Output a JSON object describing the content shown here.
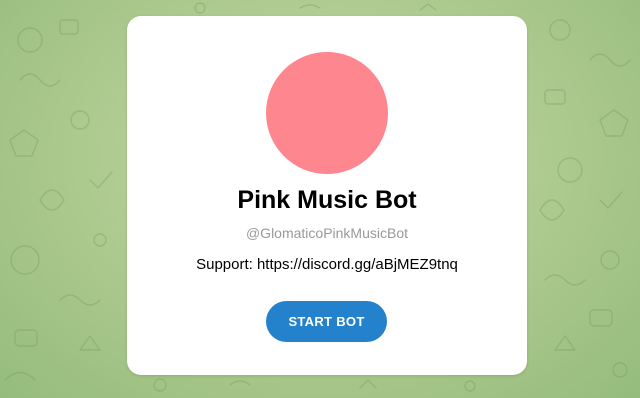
{
  "colors": {
    "avatar": "#fd868f",
    "button": "#2481cc",
    "username": "#999999"
  },
  "bot": {
    "name": "Pink Music Bot",
    "username": "@GlomaticoPinkMusicBot",
    "description": "Support: https://discord.gg/aBjMEZ9tnq"
  },
  "actions": {
    "start_label": "START BOT"
  },
  "background": {
    "pattern_icon": "doodle-pattern-icon"
  }
}
